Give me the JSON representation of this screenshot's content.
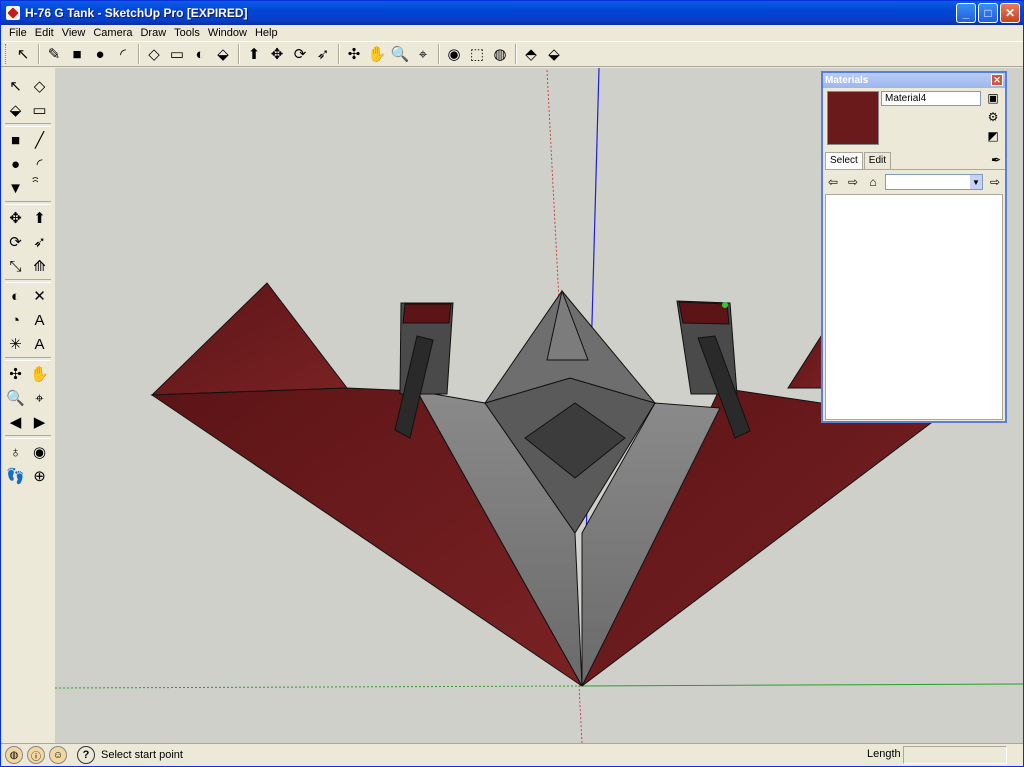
{
  "window": {
    "title": "H-76 G Tank - SketchUp Pro [EXPIRED]",
    "controls": [
      "minimize",
      "maximize",
      "close"
    ]
  },
  "menu": [
    "File",
    "Edit",
    "View",
    "Camera",
    "Draw",
    "Tools",
    "Window",
    "Help"
  ],
  "toolbar": {
    "icons": [
      {
        "name": "select-icon",
        "glyph": "↖"
      },
      {
        "name": "pencil-icon",
        "glyph": "✎"
      },
      {
        "name": "rectangle-icon",
        "glyph": "■"
      },
      {
        "name": "circle-icon",
        "glyph": "●"
      },
      {
        "name": "arc-icon",
        "glyph": "◜"
      },
      {
        "name": "make-component-icon",
        "glyph": "◇"
      },
      {
        "name": "eraser-icon",
        "glyph": "▭"
      },
      {
        "name": "tape-measure-icon",
        "glyph": "◐"
      },
      {
        "name": "paint-bucket-icon",
        "glyph": "⬙"
      },
      {
        "name": "push-pull-icon",
        "glyph": "⬆"
      },
      {
        "name": "move-icon",
        "glyph": "✥"
      },
      {
        "name": "rotate-icon",
        "glyph": "⟳"
      },
      {
        "name": "follow-me-icon",
        "glyph": "➶"
      },
      {
        "name": "orbit-icon",
        "glyph": "✣"
      },
      {
        "name": "pan-icon",
        "glyph": "✋"
      },
      {
        "name": "zoom-icon",
        "glyph": "🔍"
      },
      {
        "name": "zoom-extents-icon",
        "glyph": "⌖"
      },
      {
        "name": "get-models-icon",
        "glyph": "◉"
      },
      {
        "name": "share-model-icon",
        "glyph": "⬚"
      },
      {
        "name": "share-component-icon",
        "glyph": "◍"
      },
      {
        "name": "extension-warehouse-icon",
        "glyph": "⬘"
      },
      {
        "name": "layout-icon",
        "glyph": "⬙"
      }
    ]
  },
  "sidebar": {
    "rows": [
      [
        {
          "name": "select-tool-icon",
          "glyph": "↖"
        },
        {
          "name": "component-tool-icon",
          "glyph": "◇"
        }
      ],
      [
        {
          "name": "paint-tool-icon",
          "glyph": "⬙"
        },
        {
          "name": "eraser-tool-icon",
          "glyph": "▭"
        }
      ],
      "sep",
      [
        {
          "name": "rectangle-tool-icon",
          "glyph": "■"
        },
        {
          "name": "line-tool-icon",
          "glyph": "╱"
        }
      ],
      [
        {
          "name": "circle-tool-icon",
          "glyph": "●"
        },
        {
          "name": "arc-tool-icon",
          "glyph": "◜"
        }
      ],
      [
        {
          "name": "polygon-tool-icon",
          "glyph": "▼"
        },
        {
          "name": "freehand-tool-icon",
          "glyph": "ꩰ"
        }
      ],
      "sep",
      [
        {
          "name": "move-tool-icon",
          "glyph": "✥"
        },
        {
          "name": "push-pull-tool-icon",
          "glyph": "⬆"
        }
      ],
      [
        {
          "name": "rotate-tool-icon",
          "glyph": "⟳"
        },
        {
          "name": "follow-me-tool-icon",
          "glyph": "➶"
        }
      ],
      [
        {
          "name": "scale-tool-icon",
          "glyph": "⤡"
        },
        {
          "name": "offset-tool-icon",
          "glyph": "⟰"
        }
      ],
      "sep",
      [
        {
          "name": "tape-measure-tool-icon",
          "glyph": "◐"
        },
        {
          "name": "dimension-tool-icon",
          "glyph": "✕"
        }
      ],
      [
        {
          "name": "protractor-tool-icon",
          "glyph": "◔"
        },
        {
          "name": "text-tool-icon",
          "glyph": "A"
        }
      ],
      [
        {
          "name": "axes-tool-icon",
          "glyph": "✳"
        },
        {
          "name": "3d-text-tool-icon",
          "glyph": "A"
        }
      ],
      "sep",
      [
        {
          "name": "orbit-tool-icon",
          "glyph": "✣"
        },
        {
          "name": "pan-tool-icon",
          "glyph": "✋"
        }
      ],
      [
        {
          "name": "zoom-tool-icon",
          "glyph": "🔍"
        },
        {
          "name": "zoom-extents-tool-icon",
          "glyph": "⌖"
        }
      ],
      [
        {
          "name": "previous-view-icon",
          "glyph": "◀"
        },
        {
          "name": "next-view-icon",
          "glyph": "▶"
        }
      ],
      "sep",
      [
        {
          "name": "position-camera-icon",
          "glyph": "♁"
        },
        {
          "name": "look-around-icon",
          "glyph": "◉"
        }
      ],
      [
        {
          "name": "walk-tool-icon",
          "glyph": "👣"
        },
        {
          "name": "section-plane-icon",
          "glyph": "⊕"
        }
      ]
    ]
  },
  "materials": {
    "title": "Materials",
    "material_name": "Material4",
    "swatch_color": "#6b1a1c",
    "tabs": [
      "Select",
      "Edit"
    ],
    "active_tab": "Select",
    "library_value": ""
  },
  "status": {
    "message": "Select start point",
    "vcb_label": "Length",
    "vcb_value": ""
  },
  "colors": {
    "maroon": "#6b1a1c",
    "gray": "#7a7a7a",
    "dark_gray": "#3a3a3a",
    "axis_red": "#d04040",
    "axis_green": "#2aa02a",
    "axis_blue": "#2020d0"
  }
}
